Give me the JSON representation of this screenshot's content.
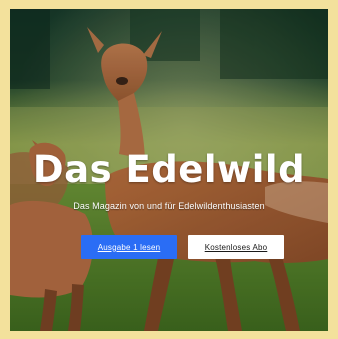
{
  "colors": {
    "frame": "#f3e19c",
    "primary_button_bg": "#2a6df5",
    "primary_button_text": "#ffffff",
    "secondary_button_bg": "#ffffff",
    "secondary_button_text": "#1a1a1a",
    "title_text": "#ffffff"
  },
  "hero": {
    "image_alt": "Deer standing in a grassy meadow",
    "title": "Das Edelwild",
    "subtitle": "Das Magazin von und für Edelwildenthusiasten",
    "primary_button_label": "Ausgabe 1 lesen",
    "secondary_button_label": "Kostenloses Abo"
  }
}
